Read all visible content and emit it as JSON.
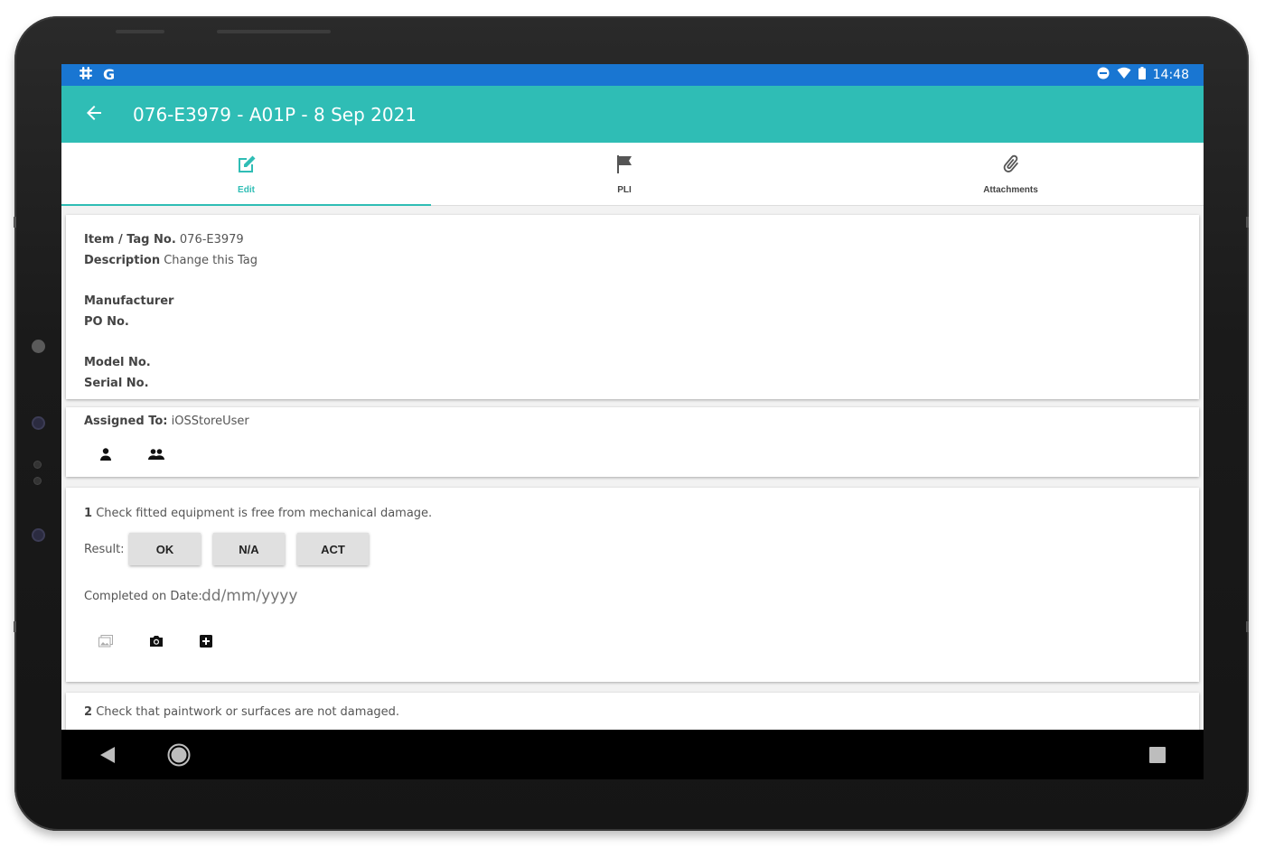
{
  "status_bar": {
    "left_icons": [
      "slack-icon",
      "google-icon"
    ],
    "right_icons": [
      "dnd-icon",
      "wifi-icon",
      "battery-icon"
    ],
    "time": "14:48"
  },
  "app_bar": {
    "back_icon": "arrow-back-icon",
    "title": "076-E3979 - A01P - 8 Sep 2021",
    "color": "#2fbdb5"
  },
  "tabs": [
    {
      "label": "Edit",
      "icon": "edit-icon",
      "active": true
    },
    {
      "label": "PLI",
      "icon": "flag-icon",
      "active": false
    },
    {
      "label": "Attachments",
      "icon": "paperclip-icon",
      "active": false
    }
  ],
  "item_details": {
    "tag_label": "Item / Tag No.",
    "tag_value": "076-E3979",
    "description_label": "Description",
    "description_value": "Change this Tag",
    "manufacturer_label": "Manufacturer",
    "po_label": "PO No.",
    "model_label": "Model No.",
    "serial_label": "Serial No."
  },
  "assignment": {
    "label": "Assigned To:",
    "value": "iOSStoreUser",
    "icons": [
      "person-icon",
      "group-icon"
    ]
  },
  "checks": [
    {
      "number": "1",
      "text": "Check fitted equipment is free from mechanical damage.",
      "result_label": "Result:",
      "result_options": [
        "OK",
        "N/A",
        "ACT"
      ],
      "date_label": "Completed on Date:",
      "date_placeholder": "dd/mm/yyyy",
      "action_icons": [
        "gallery-icon",
        "camera-icon",
        "add-box-icon"
      ]
    },
    {
      "number": "2",
      "text": "Check that paintwork or surfaces are not damaged."
    }
  ],
  "nav_bar": {
    "icons": [
      "nav-back-icon",
      "nav-home-icon",
      "nav-recents-icon"
    ]
  }
}
